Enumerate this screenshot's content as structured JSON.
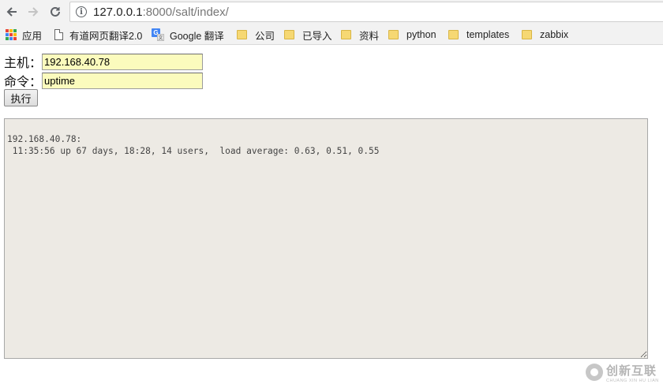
{
  "browser": {
    "url_host": "127.0.0.1",
    "url_path": ":8000/salt/index/",
    "bookmarks": [
      {
        "label": "应用",
        "icon": "apps-grid-icon"
      },
      {
        "label": "有道网页翻译2.0",
        "icon": "page-icon"
      },
      {
        "label": "Google 翻译",
        "icon": "google-translate-icon"
      },
      {
        "label": "公司",
        "icon": "folder-icon"
      },
      {
        "label": "已导入",
        "icon": "folder-icon"
      },
      {
        "label": "资料",
        "icon": "folder-icon"
      },
      {
        "label": "python",
        "icon": "folder-icon"
      },
      {
        "label": "templates",
        "icon": "folder-icon"
      },
      {
        "label": "zabbix",
        "icon": "folder-icon"
      }
    ]
  },
  "form": {
    "host_label": "主机：",
    "host_value": "192.168.40.78",
    "command_label": "命令：",
    "command_value": "uptime",
    "execute_label": "执行"
  },
  "output": {
    "text": "192.168.40.78:\n 11:35:56 up 67 days, 18:28, 14 users,  load average: 0.63, 0.51, 0.55"
  },
  "watermark": {
    "main": "创新互联",
    "sub": "CHUANG XIN HU LIAN"
  },
  "colors": {
    "input_bg": "#fbfbbd",
    "output_bg": "#edeae4",
    "folder": "#f6d873"
  }
}
